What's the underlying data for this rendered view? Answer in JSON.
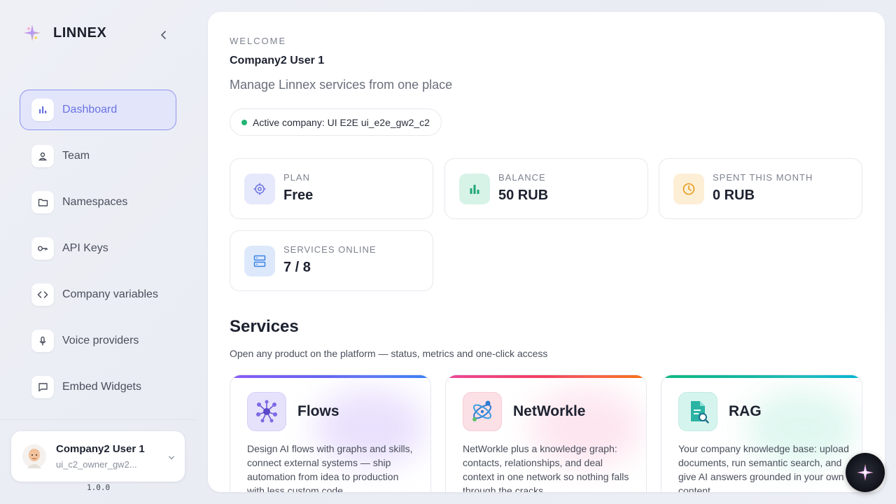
{
  "brand": {
    "name": "LINNEX"
  },
  "sidebar": {
    "items": [
      {
        "label": "Dashboard",
        "icon": "bar-chart-icon",
        "active": true
      },
      {
        "label": "Team",
        "icon": "user-icon"
      },
      {
        "label": "Namespaces",
        "icon": "folder-icon"
      },
      {
        "label": "API Keys",
        "icon": "key-icon"
      },
      {
        "label": "Company variables",
        "icon": "code-icon"
      },
      {
        "label": "Voice providers",
        "icon": "microphone-icon"
      },
      {
        "label": "Embed Widgets",
        "icon": "chat-bubble-icon"
      }
    ],
    "user": {
      "name": "Company2 User 1",
      "login": "ui_c2_owner_gw2..."
    },
    "version": "1.0.0"
  },
  "header": {
    "welcome": "WELCOME",
    "user_name": "Company2 User 1",
    "tagline": "Manage Linnex services from one place",
    "company_label": "Active company: UI E2E ui_e2e_gw2_c2"
  },
  "stats": [
    {
      "label": "PLAN",
      "value": "Free",
      "icon": "target-icon",
      "color": "#6c72e0",
      "bg": "#e6e8fb"
    },
    {
      "label": "BALANCE",
      "value": "50 RUB",
      "icon": "bar-chart-icon",
      "color": "#1fa673",
      "bg": "#d7f3e7"
    },
    {
      "label": "SPENT THIS MONTH",
      "value": "0 RUB",
      "icon": "clock-icon",
      "color": "#e89a1c",
      "bg": "#fdefd6"
    },
    {
      "label": "SERVICES ONLINE",
      "value": "7 / 8",
      "icon": "server-icon",
      "color": "#3b82e6",
      "bg": "#dde9fb"
    }
  ],
  "services_section": {
    "title": "Services",
    "subtitle": "Open any product on the platform — status, metrics and one-click access"
  },
  "services": [
    {
      "name": "Flows",
      "icon": "network-nodes-icon",
      "description": "Design AI flows with graphs and skills, connect external systems — ship automation from idea to production with less custom code",
      "accent": "#8b5cf6"
    },
    {
      "name": "NetWorkle",
      "icon": "molecule-icon",
      "description": "NetWorkle plus a knowledge graph: contacts, relationships, and deal context in one network so nothing falls through the cracks",
      "accent": "#ec4899"
    },
    {
      "name": "RAG",
      "icon": "document-search-icon",
      "description": "Your company knowledge base: upload documents, run semantic search, and give AI answers grounded in your own content",
      "accent": "#14b8a6"
    }
  ]
}
